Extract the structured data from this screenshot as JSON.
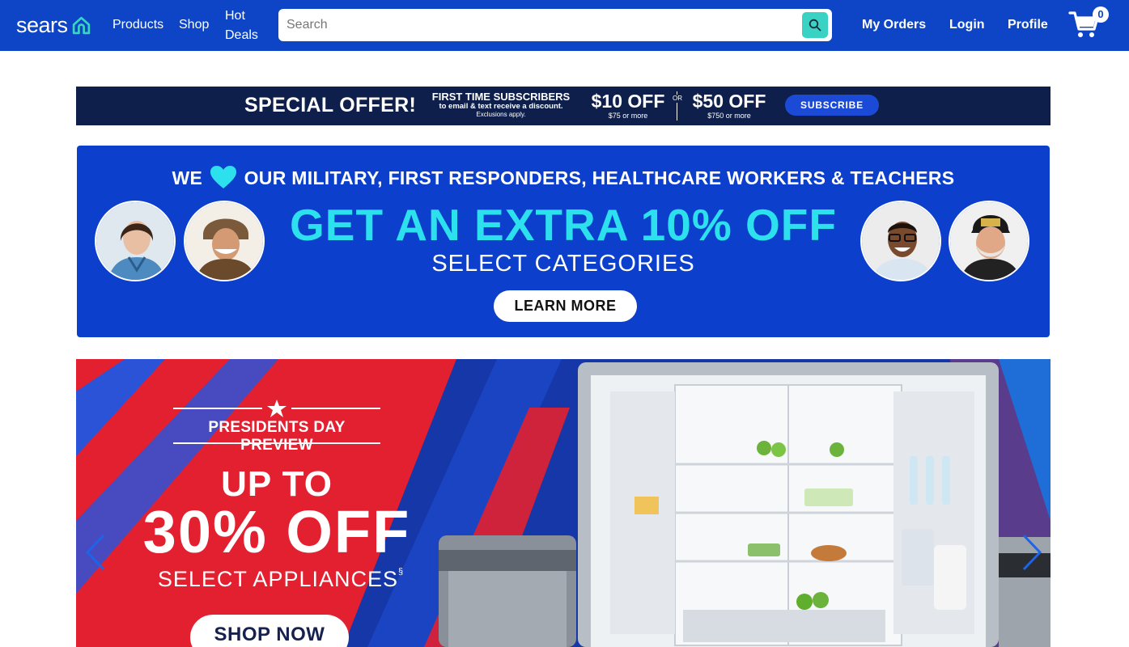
{
  "header": {
    "logo_text": "sears",
    "nav": [
      "Products",
      "Shop",
      "Hot Deals"
    ],
    "search": {
      "placeholder": "Search",
      "value": ""
    },
    "links": {
      "orders": "My Orders",
      "login": "Login",
      "profile": "Profile"
    },
    "cart_count": "0",
    "colors": {
      "header_bg": "#0d45c6",
      "search_btn": "#3ad3c3"
    },
    "icons": [
      "sears-home-icon",
      "search-icon",
      "cart-icon"
    ]
  },
  "subscribe_banner": {
    "headline": "SPECIAL OFFER!",
    "subscribers_line": "FIRST TIME SUBSCRIBERS",
    "discount_line": "to email & text receive a discount.",
    "exclusions": "Exclusions apply.",
    "offer1": {
      "amount": "$10 OFF",
      "min": "$75 or more"
    },
    "or_text": "OR",
    "offer2": {
      "amount": "$50 OFF",
      "min": "$750 or more"
    },
    "button": "SUBSCRIBE"
  },
  "military_banner": {
    "top_prefix": "WE",
    "top_suffix": "OUR MILITARY, FIRST RESPONDERS, HEALTHCARE WORKERS & TEACHERS",
    "headline": "GET AN EXTRA 10% OFF",
    "subline": "SELECT CATEGORIES",
    "button": "LEARN MORE",
    "heart_color": "#2de0ee"
  },
  "presidents_banner": {
    "kicker": "PRESIDENTS DAY PREVIEW",
    "upto": "UP TO",
    "percent": "30% OFF",
    "select": "SELECT APPLIANCES",
    "select_mark": "§",
    "button": "SHOP NOW",
    "colors": {
      "red": "#e3202f",
      "blue": "#1637a8"
    }
  }
}
